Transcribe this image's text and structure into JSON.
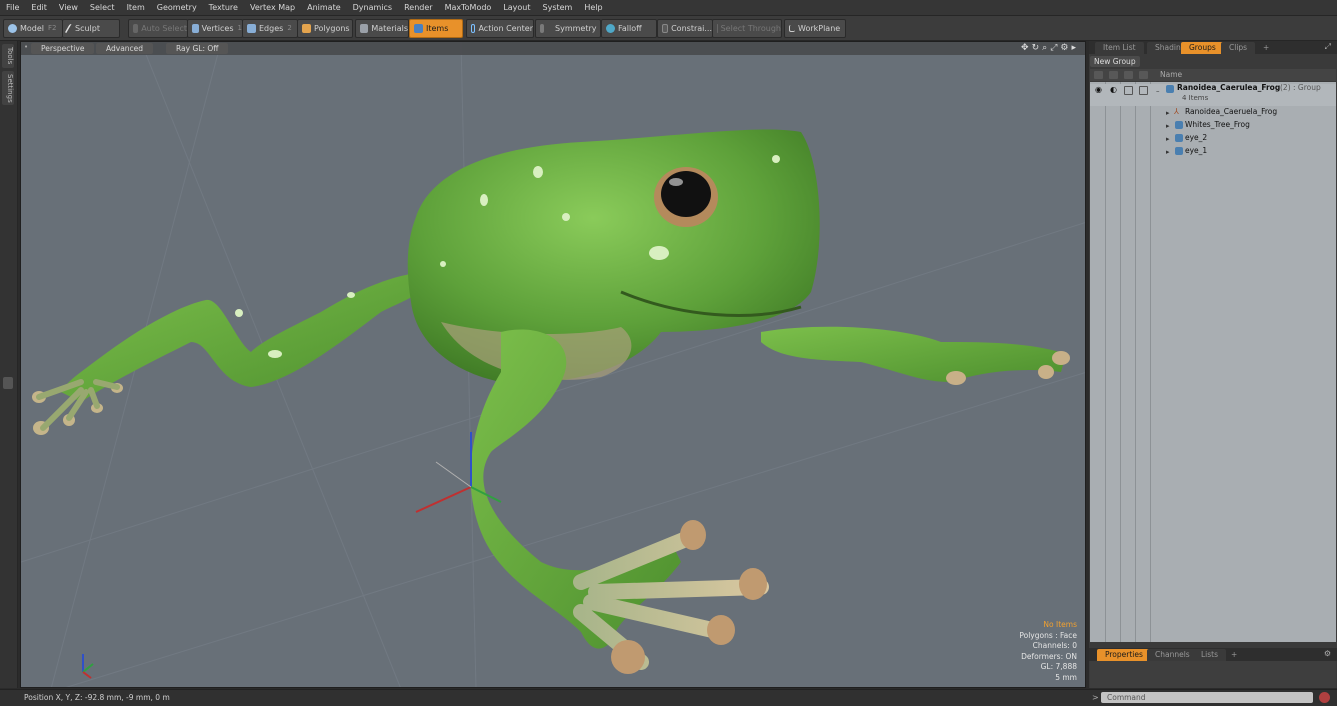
{
  "menu": [
    "File",
    "Edit",
    "View",
    "Select",
    "Item",
    "Geometry",
    "Texture",
    "Vertex Map",
    "Animate",
    "Dynamics",
    "Render",
    "MaxToModo",
    "Layout",
    "System",
    "Help"
  ],
  "toolbar": {
    "model": "Model",
    "model_key": "F2",
    "sculpt": "Sculpt",
    "auto_select": "Auto Select",
    "vertices": "Vertices",
    "vertices_key": "1",
    "edges": "Edges",
    "edges_key": "2",
    "polygons": "Polygons",
    "materials": "Materials",
    "items": "Items",
    "action_center": "Action Center",
    "symmetry": "Symmetry",
    "falloff": "Falloff",
    "constraints": "Constrai...",
    "select_through": "Select Through",
    "workplane": "WorkPlane"
  },
  "left_tabs": [
    "Tools",
    "Settings"
  ],
  "viewport": {
    "view": "Perspective",
    "mode": "Advanced",
    "raygl": "Ray GL: Off",
    "info": {
      "selection": "No Items",
      "polygons": "Polygons : Face",
      "channels": "Channels: 0",
      "deformers": "Deformers: ON",
      "gl": "GL: 7,888",
      "scale": "5 mm"
    }
  },
  "status": {
    "position": "Position X, Y, Z:   -92.8 mm, -9 mm, 0 m"
  },
  "command": {
    "placeholder": "Command"
  },
  "right_panel": {
    "tabs": [
      "Item List",
      "Shading",
      "Groups",
      "Clips",
      "+"
    ],
    "active_tab": "Groups",
    "new_group": "New Group",
    "name_header": "Name",
    "group": {
      "name": "Ranoidea_Caerulea_Frog",
      "suffix": "(2) : Group",
      "count": "4 Items"
    },
    "items": [
      "Ranoidea_Caeruela_Frog",
      "Whites_Tree_Frog",
      "eye_2",
      "eye_1"
    ],
    "bottom_tabs": [
      "Properties",
      "Channels",
      "Lists",
      "+"
    ]
  },
  "colors": {
    "accent": "#e8912a",
    "frog": "#5fa43a",
    "viewport_bg": "#687078"
  }
}
